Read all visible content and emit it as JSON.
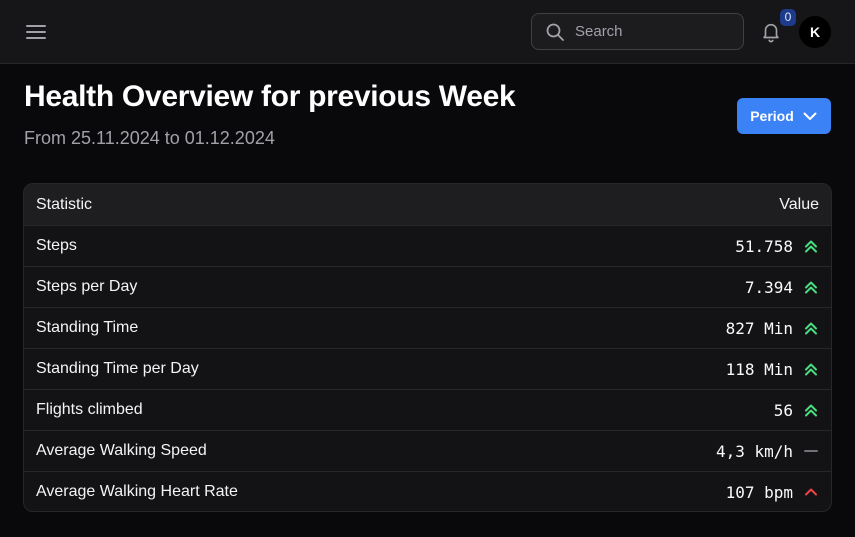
{
  "header": {
    "search_placeholder": "Search",
    "notification_count": "0",
    "avatar_initial": "K"
  },
  "page": {
    "title": "Health Overview for previous Week",
    "subtitle": "From 25.11.2024 to 01.12.2024",
    "period_label": "Period"
  },
  "table": {
    "columns": [
      "Statistic",
      "Value"
    ],
    "rows": [
      {
        "name": "Steps",
        "value": "51.758",
        "trend": "double-up"
      },
      {
        "name": "Steps per Day",
        "value": "7.394",
        "trend": "double-up"
      },
      {
        "name": "Standing Time",
        "value": "827 Min",
        "trend": "double-up"
      },
      {
        "name": "Standing Time per Day",
        "value": "118 Min",
        "trend": "double-up"
      },
      {
        "name": "Flights climbed",
        "value": "56",
        "trend": "double-up"
      },
      {
        "name": "Average Walking Speed",
        "value": "4,3 km/h",
        "trend": "neutral"
      },
      {
        "name": "Average Walking Heart Rate",
        "value": "107 bpm",
        "trend": "up-bad"
      }
    ]
  },
  "colors": {
    "accent": "#3b82f6",
    "trend_good": "#4ade80",
    "trend_bad": "#ef4444",
    "trend_neutral": "#71717a"
  }
}
